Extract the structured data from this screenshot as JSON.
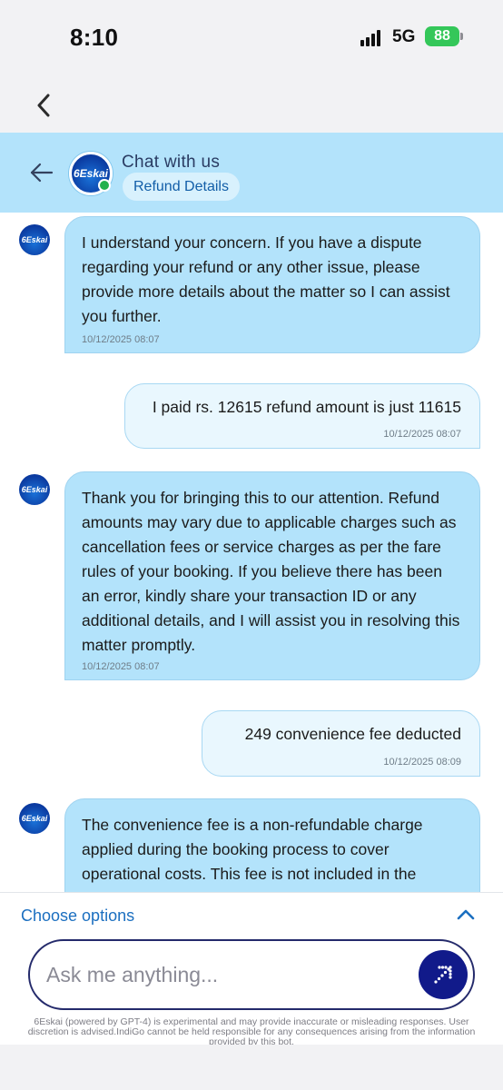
{
  "status_bar": {
    "time": "8:10",
    "network": "5G",
    "battery": "88"
  },
  "chat_header": {
    "avatar_text": "6Eskai",
    "title": "Chat with us",
    "subtitle": "Refund Details"
  },
  "messages": [
    {
      "sender": "bot",
      "avatar_text": "6Eskai",
      "text": "I understand your concern. If you have a dispute regarding your refund or any other issue, please provide more details about the matter so I can assist you further.",
      "timestamp": "10/12/2025 08:07"
    },
    {
      "sender": "user",
      "text": "I paid rs. 12615 refund amount is just 11615",
      "timestamp": "10/12/2025 08:07"
    },
    {
      "sender": "bot",
      "avatar_text": "6Eskai",
      "text": "Thank you for bringing this to our attention. Refund amounts may vary due to applicable charges such as cancellation fees or service charges as per the fare rules of your booking. If you believe there has been an error, kindly share your transaction ID or any additional details, and I will assist you in resolving this matter promptly.",
      "timestamp": "10/12/2025 08:07"
    },
    {
      "sender": "user",
      "text": "249 convenience fee deducted",
      "timestamp": "10/12/2025 08:09"
    },
    {
      "sender": "bot",
      "avatar_text": "6Eskai",
      "text": "The convenience fee is a non-refundable charge applied during the booking process to cover operational costs. This fee is not included in the"
    }
  ],
  "options": {
    "label": "Choose options"
  },
  "input": {
    "placeholder": "Ask me anything..."
  },
  "disclaimer": "6Eskai (powered by GPT-4) is experimental and may provide inaccurate or misleading responses. User discretion is advised.IndiGo cannot be held responsible for any consequences arising from the information provided by this bot.",
  "colors": {
    "header_bg": "#b3e3fb",
    "bot_bubble": "#b3e3fb",
    "user_bubble": "#e9f7fe",
    "accent": "#1b6fc0",
    "send_button": "#111a8a",
    "online": "#22b14c"
  }
}
